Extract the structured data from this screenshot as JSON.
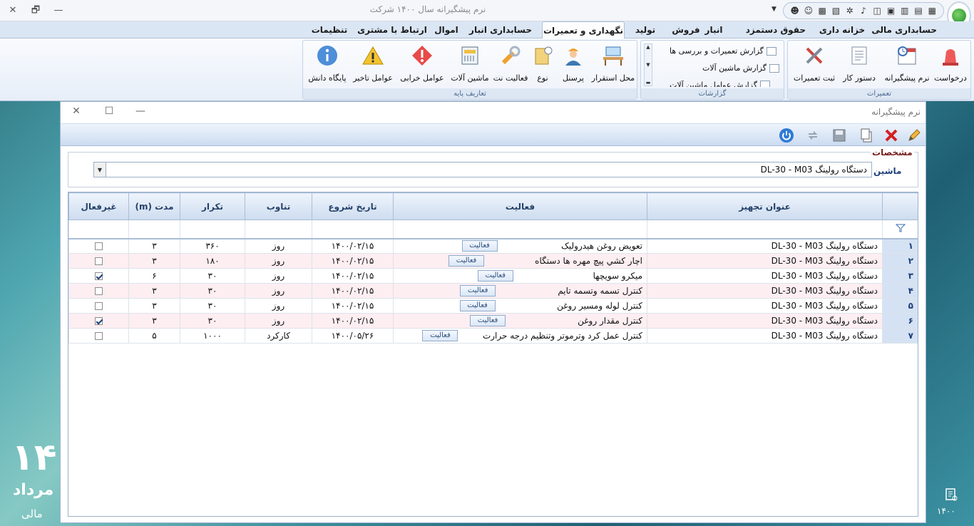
{
  "titlebar": {
    "title": "نرم پیشگیرانه    سال ۱۴۰۰ شرکت",
    "close": "✕",
    "restore": "🗗",
    "minimize": "—",
    "quick_access_icons": [
      "calendar-icon",
      "calculator-icon",
      "grid-icon",
      "users-icon",
      "contact-icon",
      "bell-icon",
      "settings-icon",
      "card-icon",
      "keyboard-icon",
      "user-search-icon",
      "user-key-icon"
    ]
  },
  "menu": {
    "tabs": [
      {
        "label": "حسابداری مالی"
      },
      {
        "label": "خزانه داری"
      },
      {
        "label": "حقوق دستمزد"
      },
      {
        "label": "انبار"
      },
      {
        "label": "فروش"
      },
      {
        "label": "تولید"
      },
      {
        "label": "نگهداری و تعمیرات"
      },
      {
        "label": "حسابداری انبار"
      },
      {
        "label": "اموال"
      },
      {
        "label": "ارتباط با مشتری"
      },
      {
        "label": "تنظیمات"
      }
    ],
    "active": "نگهداری و تعمیرات"
  },
  "ribbon": {
    "repairs": {
      "label": "تعمیرات",
      "buttons": [
        "درخواست",
        "نرم پیشگیرانه",
        "دستور کار",
        "ثبت تعمیرات"
      ]
    },
    "reports": {
      "label": "گزارشات",
      "items": [
        "گزارش تعمیرات و بررسی ها",
        "گزارش ماشین آلات",
        "گزارش عوامل ماشین آلات"
      ]
    },
    "base": {
      "label": "تعاریف پایه",
      "buttons": [
        "محل استقرار",
        "پرسنل",
        "نوع",
        "فعالیت نت",
        "ماشین آلات",
        "عوامل خرابی",
        "عوامل تاخیر",
        "پایگاه دانش"
      ]
    }
  },
  "window": {
    "title": "نرم پیشگیرانه",
    "specs_title": "مشخصات",
    "machine_label": "ماشین",
    "machine_value": "دستگاه رولینگ DL-30 - M03"
  },
  "grid": {
    "columns": [
      "عنوان تجهیز",
      "فعالیت",
      "تاریخ شروع",
      "تناوب",
      "تکرار",
      "مدت (m)",
      "غیرفعال"
    ],
    "activity_button": "فعالیت",
    "rows": [
      {
        "idx": "۱",
        "equip": "دستگاه رولینگ DL-30 - M03",
        "activity": "تعویض روغن هیدرولیک",
        "start": "۱۴۰۰/۰۲/۱۵",
        "period": "روز",
        "repeat": "۳۶۰",
        "duration": "۳",
        "inactive": false
      },
      {
        "idx": "۲",
        "equip": "دستگاه رولینگ DL-30 - M03",
        "activity": "اچار کشي  پیچ مهره ها دستگاه",
        "start": "۱۴۰۰/۰۲/۱۵",
        "period": "روز",
        "repeat": "۱۸۰",
        "duration": "۳",
        "inactive": false
      },
      {
        "idx": "۳",
        "equip": "دستگاه رولینگ DL-30 - M03",
        "activity": "میکرو سویچها",
        "start": "۱۴۰۰/۰۲/۱۵",
        "period": "روز",
        "repeat": "۳۰",
        "duration": "۶",
        "inactive": true
      },
      {
        "idx": "۴",
        "equip": "دستگاه رولینگ DL-30 - M03",
        "activity": "کنترل تسمه وتسمه تایم",
        "start": "۱۴۰۰/۰۲/۱۵",
        "period": "روز",
        "repeat": "۳۰",
        "duration": "۳",
        "inactive": false
      },
      {
        "idx": "۵",
        "equip": "دستگاه رولینگ DL-30 - M03",
        "activity": "کنترل لوله ومسیر روغن",
        "start": "۱۴۰۰/۰۲/۱۵",
        "period": "روز",
        "repeat": "۳۰",
        "duration": "۳",
        "inactive": false
      },
      {
        "idx": "۶",
        "equip": "دستگاه رولینگ DL-30 - M03",
        "activity": "کنترل مقدار روغن",
        "start": "۱۴۰۰/۰۲/۱۵",
        "period": "روز",
        "repeat": "۳۰",
        "duration": "۳",
        "inactive": true
      },
      {
        "idx": "۷",
        "equip": "دستگاه رولینگ DL-30 - M03",
        "activity": "کنترل عمل کرد وترموتر وتنظیم درجه حرارت",
        "start": "۱۴۰۰/۰۵/۲۶",
        "period": "کارکرد",
        "repeat": "۱۰۰۰",
        "duration": "۵",
        "inactive": false
      }
    ]
  },
  "desktop": {
    "day": "۱۴",
    "month": "مرداد",
    "fiscal": "مالی",
    "year": "۱۴۰۰"
  },
  "colors": {
    "accent": "#1e3f7a",
    "row_alt": "#fdeef2",
    "header": "#cddcef"
  }
}
